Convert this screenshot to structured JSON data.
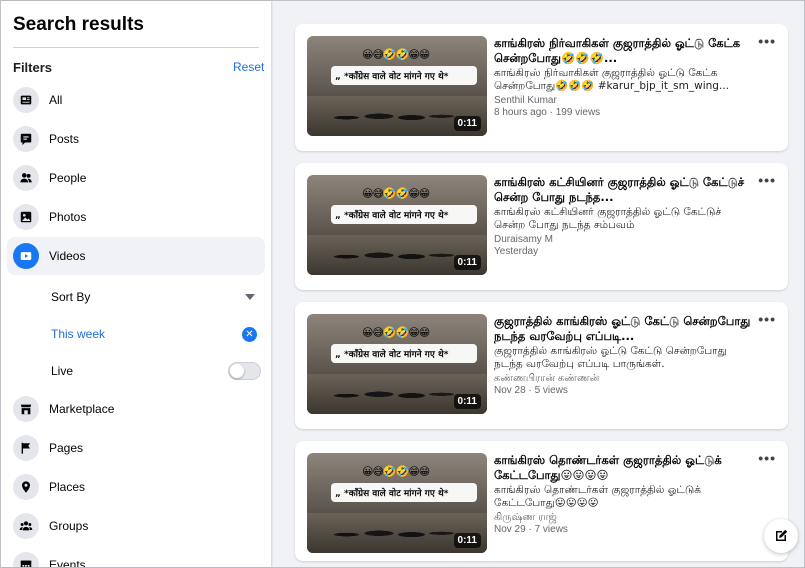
{
  "sidebar": {
    "title": "Search results",
    "filters_label": "Filters",
    "reset_label": "Reset",
    "items": [
      {
        "label": "All",
        "icon": "feed-icon"
      },
      {
        "label": "Posts",
        "icon": "posts-icon"
      },
      {
        "label": "People",
        "icon": "people-icon"
      },
      {
        "label": "Photos",
        "icon": "photos-icon"
      },
      {
        "label": "Videos",
        "icon": "video-icon",
        "active": true
      },
      {
        "label": "Marketplace",
        "icon": "marketplace-icon"
      },
      {
        "label": "Pages",
        "icon": "flag-icon"
      },
      {
        "label": "Places",
        "icon": "location-pin-icon"
      },
      {
        "label": "Groups",
        "icon": "groups-icon"
      },
      {
        "label": "Events",
        "icon": "calendar-icon"
      }
    ],
    "sort_by": {
      "label": "Sort By"
    },
    "date_filter": {
      "label": "This week"
    },
    "live": {
      "label": "Live",
      "on": false
    }
  },
  "results": [
    {
      "title": "காங்கிரஸ் நிர்வாகிகள் குஜராத்தில் ஓட்டு கேட்க சென்றபோது🤣🤣🤣...",
      "description": "காங்கிரஸ் நிர்வாகிகள் குஜராத்தில் ஓட்டு கேட்க சென்றபோது🤣🤣🤣 #karur_bjp_it_sm_wing...",
      "author": "Senthil Kumar",
      "meta": "8 hours ago · 199 views",
      "duration": "0:11",
      "overlay_emoji": "😀😅🤣🤣😁😁",
      "overlay_text": "„ *कॉंग्रेस वाले वोट मांगने गए थे*"
    },
    {
      "title": "காங்கிரஸ் கட்சியினர் குஜராத்தில் ஓட்டு கேட்டுச் சென்ற போது நடந்த...",
      "description": "காங்கிரஸ் கட்சியினர் குஜராத்தில் ஓட்டு கேட்டுச் சென்ற போது நடந்த சம்பவம்",
      "author": "Duraisamy M",
      "meta": "Yesterday",
      "duration": "0:11",
      "overlay_emoji": "😀😅🤣🤣😁😁",
      "overlay_text": "„ *कॉंग्रेस वाले वोट मांगने गए थे*"
    },
    {
      "title": "குஜராத்தில் காங்கிரஸ் ஓட்டு கேட்டு சென்றபோது நடந்த வரவேற்பு எப்படி...",
      "description": "குஜராத்தில் காங்கிரஸ் ஓட்டு கேட்டு சென்றபோது நடந்த வரவேற்பு எப்படி பாருங்கள்.",
      "author": "கண்ணபிரான் கண்ணன்",
      "meta": "Nov 28 · 5 views",
      "duration": "0:11",
      "overlay_emoji": "😀😅🤣🤣😁😁",
      "overlay_text": "„ *कॉंग्रेस वाले वोट मांगने गए थे*"
    },
    {
      "title": "காங்கிரஸ் தொண்டர்கள் குஜராத்தில் ஓட்டுக் கேட்டபோது😛😛😛😛",
      "description": "காங்கிரஸ் தொண்டர்கள் குஜராத்தில் ஓட்டுக் கேட்டபோது😛😛😛😛",
      "author": "கிருஷ்ண ராஜ்",
      "meta": "Nov 29 · 7 views",
      "duration": "0:11",
      "overlay_emoji": "😀😅🤣🤣😁😁",
      "overlay_text": "„ *कॉंग्रेस वाले वोट मांगने गए थे*"
    }
  ],
  "colors": {
    "accent": "#1877f2",
    "link": "#216fdb",
    "background": "#f0f2f5"
  }
}
